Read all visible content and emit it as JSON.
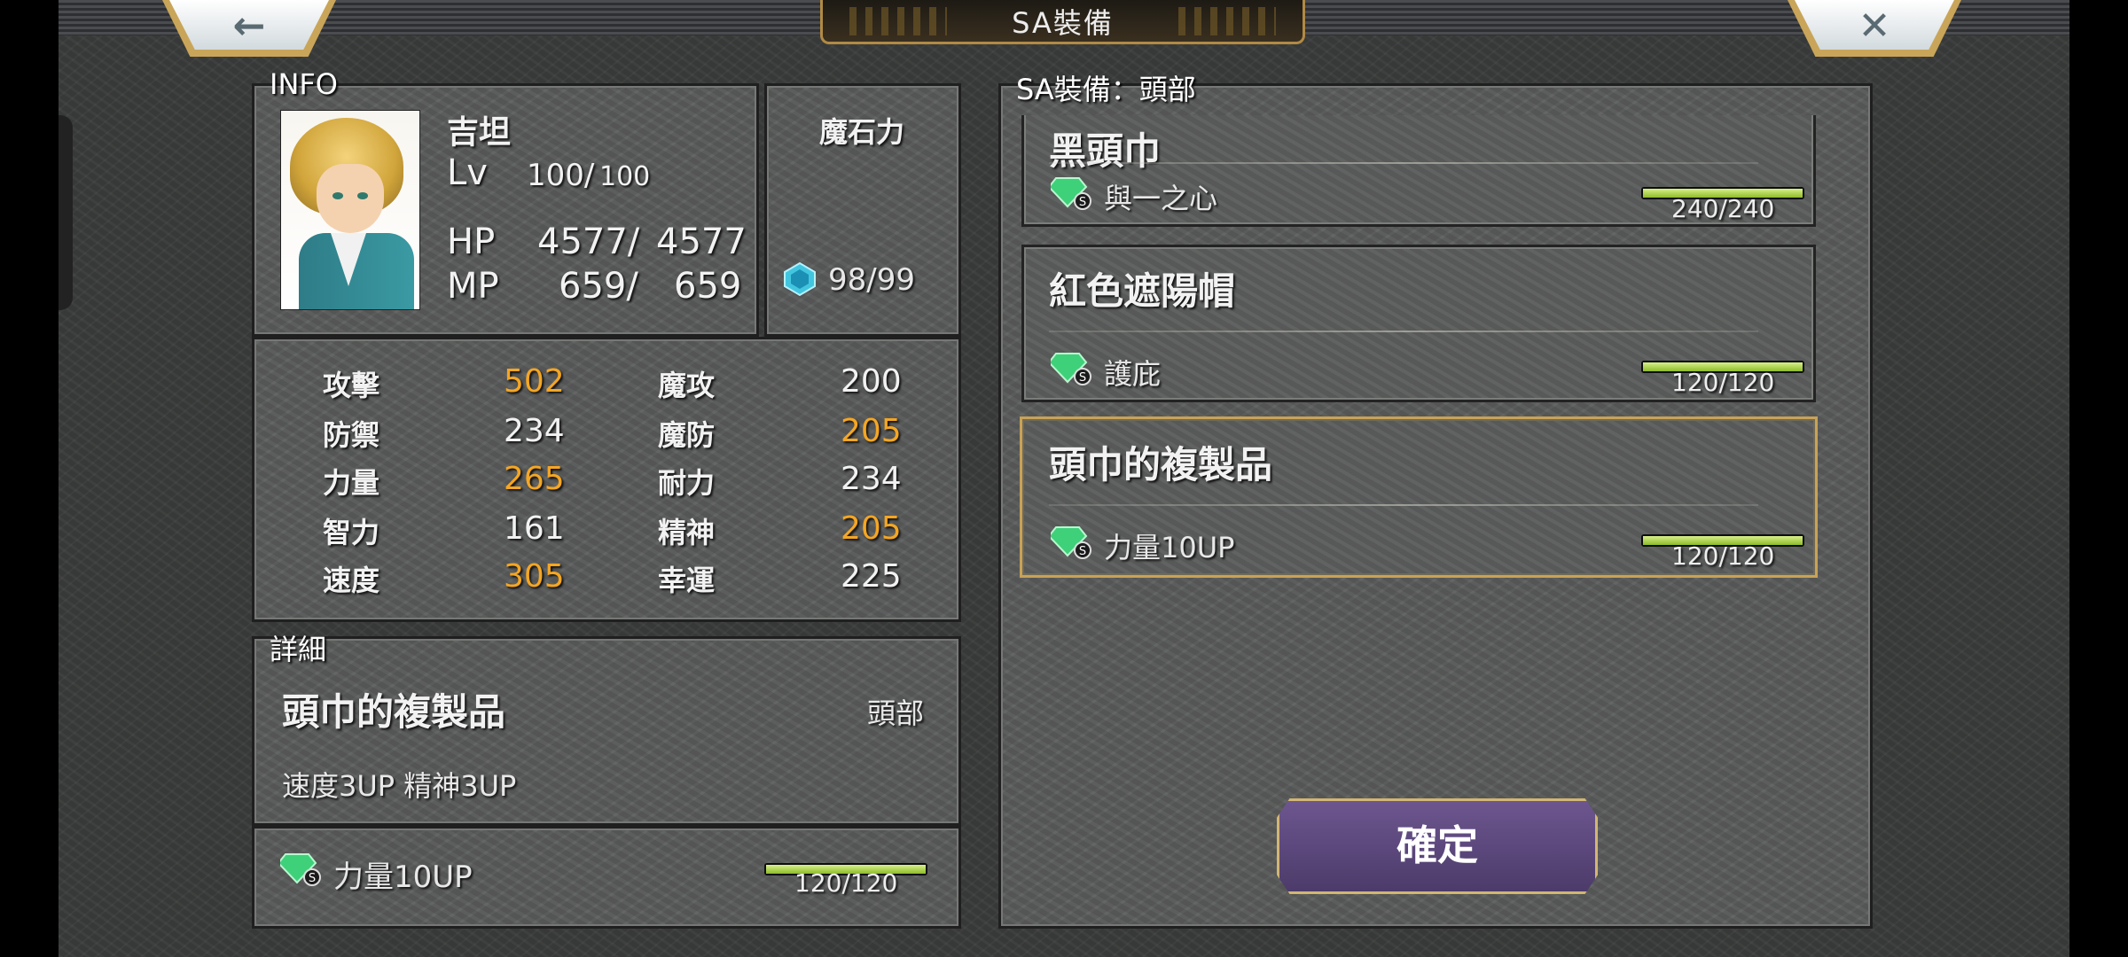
{
  "header": {
    "title": "SA裝備",
    "back_icon": "←",
    "close_icon": "✕"
  },
  "info": {
    "section_label": "INFO",
    "name": "吉坦",
    "lv_label": "Lv",
    "lv_value": "100/",
    "lv_max": "100",
    "hp_label": "HP",
    "hp_value": "4577/",
    "hp_max": "4577",
    "mp_label": "MP",
    "mp_value": "659/",
    "mp_max": "659",
    "magicite_label": "魔石力",
    "magicite_value": "98/99"
  },
  "stats": [
    {
      "label": "攻擊",
      "value": "502",
      "highlight": true
    },
    {
      "label": "魔攻",
      "value": "200",
      "highlight": false
    },
    {
      "label": "防禦",
      "value": "234",
      "highlight": false
    },
    {
      "label": "魔防",
      "value": "205",
      "highlight": true
    },
    {
      "label": "力量",
      "value": "265",
      "highlight": true
    },
    {
      "label": "耐力",
      "value": "234",
      "highlight": false
    },
    {
      "label": "智力",
      "value": "161",
      "highlight": false
    },
    {
      "label": "精神",
      "value": "205",
      "highlight": true
    },
    {
      "label": "速度",
      "value": "305",
      "highlight": true
    },
    {
      "label": "幸運",
      "value": "225",
      "highlight": false
    }
  ],
  "detail": {
    "section_label": "詳細",
    "item_name": "頭巾的複製品",
    "slot": "頭部",
    "effect": "速度3UP  精神3UP",
    "ability": "力量10UP",
    "ability_progress": "120/120",
    "ability_fraction": 1.0
  },
  "equip_list": {
    "section_label": "SA裝備：頭部",
    "items": [
      {
        "name": "黑頭巾",
        "ability": "與一之心",
        "progress": "240/240",
        "fraction": 1.0,
        "selected": false
      },
      {
        "name": "紅色遮陽帽",
        "ability": "護庇",
        "progress": "120/120",
        "fraction": 1.0,
        "selected": false
      },
      {
        "name": "頭巾的複製品",
        "ability": "力量10UP",
        "progress": "120/120",
        "fraction": 1.0,
        "selected": true
      }
    ]
  },
  "confirm_label": "確定",
  "colors": {
    "highlight": "#f5a623",
    "bar_fill": "#a6d23c",
    "selected_border": "#c8a257",
    "confirm_bg": "#5c4a7c"
  }
}
